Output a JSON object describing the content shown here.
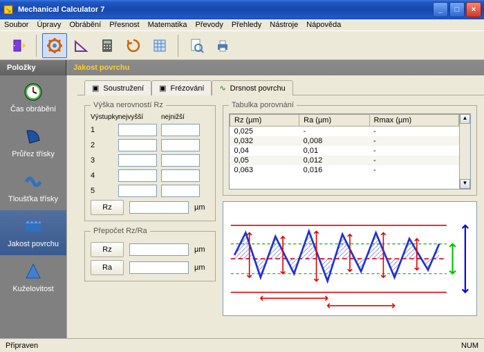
{
  "window": {
    "title": "Mechanical Calculator 7"
  },
  "menu": [
    "Soubor",
    "Úpravy",
    "Obrábění",
    "Přesnost",
    "Matematika",
    "Převody",
    "Přehledy",
    "Nástroje",
    "Nápověda"
  ],
  "leftHeader": "Položky",
  "pageHeader": "Jakost povrchu",
  "sidebar": {
    "items": [
      {
        "label": "Čas obrábění"
      },
      {
        "label": "Průřez třísky"
      },
      {
        "label": "Tloušťka třísky"
      },
      {
        "label": "Jakost povrchu"
      },
      {
        "label": "Kuželovitost"
      }
    ]
  },
  "tabs": [
    "Soustružení",
    "Frézování",
    "Drsnost povrchu"
  ],
  "panel1": {
    "legend": "Výška nerovností Rz",
    "colLabel": "Výstupky",
    "col1": "nejvyšší",
    "col2": "nejnižší",
    "rows": [
      "1",
      "2",
      "3",
      "4",
      "5"
    ],
    "rzBtn": "Rz",
    "unit": "µm"
  },
  "panel2": {
    "legend": "Přepočet Rz/Ra",
    "rzBtn": "Rz",
    "raBtn": "Ra",
    "unit": "µm"
  },
  "tablePanel": {
    "legend": "Tabulka porovnání",
    "headers": [
      "Rz (µm)",
      "Ra (µm)",
      "Rmax (µm)"
    ],
    "rows": [
      [
        "0,025",
        "-",
        "-"
      ],
      [
        "0,032",
        "0,008",
        "-"
      ],
      [
        "0,04",
        "0,01",
        "-"
      ],
      [
        "0,05",
        "0,012",
        "-"
      ],
      [
        "0,063",
        "0,016",
        "-"
      ]
    ]
  },
  "status": {
    "left": "Připraven",
    "right": "NUM"
  }
}
